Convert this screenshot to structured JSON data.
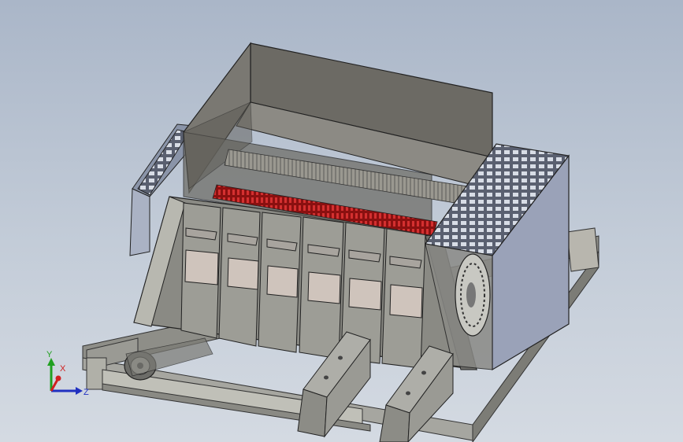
{
  "viewport": {
    "background_top": "#aab6c8",
    "background_bottom": "#d4dae2",
    "model_description_icon": "shredder-machine-model"
  },
  "triad": {
    "x_label": "X",
    "y_label": "Y",
    "z_label": "Z",
    "x_color": "#d02020",
    "y_color": "#20a020",
    "z_color": "#2030c0"
  }
}
